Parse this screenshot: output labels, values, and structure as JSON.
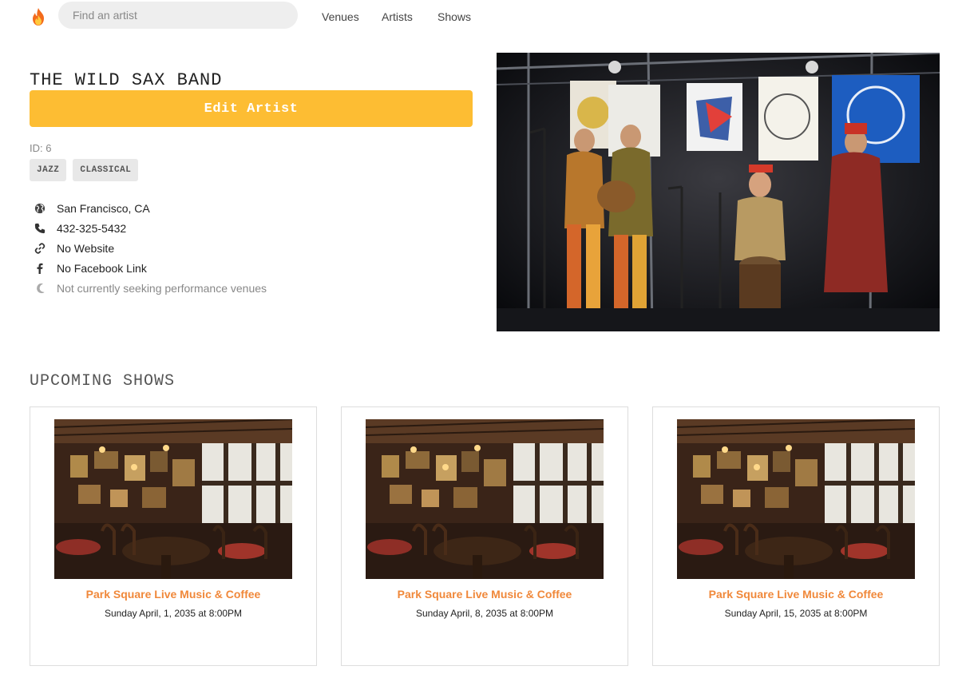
{
  "nav": {
    "logo_icon": "flame-icon",
    "search_placeholder": "Find an artist",
    "links": [
      "Venues",
      "Artists",
      "Shows"
    ]
  },
  "artist": {
    "name": "THE WILD SAX BAND",
    "edit_label": "Edit Artist",
    "id_text": "ID: 6",
    "genres": [
      "JAZZ",
      "CLASSICAL"
    ],
    "details": [
      {
        "icon": "globe-icon",
        "text": "San Francisco, CA"
      },
      {
        "icon": "phone-icon",
        "text": "432-325-5432"
      },
      {
        "icon": "link-icon",
        "text": "No Website"
      },
      {
        "icon": "facebook-icon",
        "text": "No Facebook Link"
      },
      {
        "icon": "moon-icon",
        "text": "Not currently seeking performance venues"
      }
    ]
  },
  "upcoming": {
    "title": "UPCOMING SHOWS",
    "shows": [
      {
        "venue": "Park Square Live Music & Coffee",
        "when": "Sunday April, 1, 2035 at 8:00PM"
      },
      {
        "venue": "Park Square Live Music & Coffee",
        "when": "Sunday April, 8, 2035 at 8:00PM"
      },
      {
        "venue": "Park Square Live Music & Coffee",
        "when": "Sunday April, 15, 2035 at 8:00PM"
      }
    ]
  },
  "colors": {
    "accent": "#fdbd33",
    "venue_link": "#f0883a"
  }
}
